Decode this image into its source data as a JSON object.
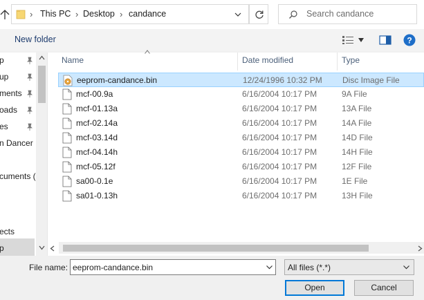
{
  "address": {
    "segments": [
      "This PC",
      "Desktop",
      "candance"
    ],
    "search_placeholder": "Search candance"
  },
  "toolbar": {
    "new_folder_label": "New folder"
  },
  "nav": {
    "items": [
      {
        "label": "p",
        "pinned": true
      },
      {
        "label": "up",
        "pinned": true
      },
      {
        "label": "ments",
        "pinned": true
      },
      {
        "label": "oads",
        "pinned": true
      },
      {
        "label": "es",
        "pinned": true
      },
      {
        "label": "n Dancer",
        "pinned": false
      },
      {
        "label": "cuments (",
        "pinned": false
      },
      {
        "label": "ects",
        "pinned": false
      },
      {
        "label": "p",
        "pinned": false,
        "selected": true
      }
    ]
  },
  "columns": {
    "name": "Name",
    "date": "Date modified",
    "type": "Type"
  },
  "files": [
    {
      "name": "eeprom-candance.bin",
      "date": "12/24/1996 10:32 PM",
      "type": "Disc Image File",
      "selected": true,
      "icon": "disc-image-icon"
    },
    {
      "name": "mcf-00.9a",
      "date": "6/16/2004 10:17 PM",
      "type": "9A File",
      "icon": "file-icon"
    },
    {
      "name": "mcf-01.13a",
      "date": "6/16/2004 10:17 PM",
      "type": "13A File",
      "icon": "file-icon"
    },
    {
      "name": "mcf-02.14a",
      "date": "6/16/2004 10:17 PM",
      "type": "14A File",
      "icon": "file-icon"
    },
    {
      "name": "mcf-03.14d",
      "date": "6/16/2004 10:17 PM",
      "type": "14D File",
      "icon": "file-icon"
    },
    {
      "name": "mcf-04.14h",
      "date": "6/16/2004 10:17 PM",
      "type": "14H File",
      "icon": "file-icon"
    },
    {
      "name": "mcf-05.12f",
      "date": "6/16/2004 10:17 PM",
      "type": "12F File",
      "icon": "file-icon"
    },
    {
      "name": "sa00-0.1e",
      "date": "6/16/2004 10:17 PM",
      "type": "1E File",
      "icon": "file-icon"
    },
    {
      "name": "sa01-0.13h",
      "date": "6/16/2004 10:17 PM",
      "type": "13H File",
      "icon": "file-icon"
    }
  ],
  "bottom": {
    "file_name_label": "File name:",
    "file_name_value": "eeprom-candance.bin",
    "file_type_value": "All files (*.*)",
    "open_label": "Open",
    "cancel_label": "Cancel"
  },
  "colors": {
    "selection_bg": "#cce8ff",
    "selection_border": "#99d1ff",
    "accent": "#0078d7"
  }
}
